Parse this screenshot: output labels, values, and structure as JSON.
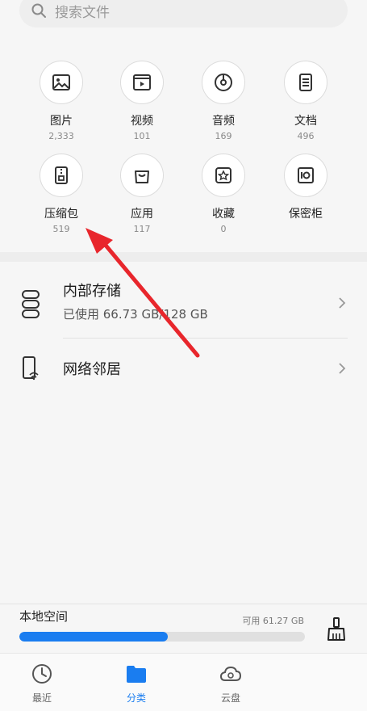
{
  "search": {
    "placeholder": "搜索文件"
  },
  "categories": [
    {
      "label": "图片",
      "count": "2,333",
      "icon": "image-icon"
    },
    {
      "label": "视频",
      "count": "101",
      "icon": "video-icon"
    },
    {
      "label": "音频",
      "count": "169",
      "icon": "audio-icon"
    },
    {
      "label": "文档",
      "count": "496",
      "icon": "document-icon"
    },
    {
      "label": "压缩包",
      "count": "519",
      "icon": "archive-icon"
    },
    {
      "label": "应用",
      "count": "117",
      "icon": "app-icon"
    },
    {
      "label": "收藏",
      "count": "0",
      "icon": "favorite-icon"
    },
    {
      "label": "保密柜",
      "count": "",
      "icon": "safe-icon"
    }
  ],
  "locations": [
    {
      "title": "内部存储",
      "subtitle": "已使用 66.73 GB/128 GB",
      "icon": "storage-icon"
    },
    {
      "title": "网络邻居",
      "subtitle": "",
      "icon": "network-device-icon"
    }
  ],
  "storage": {
    "title": "本地空间",
    "available": "可用 61.27 GB",
    "used_fraction": 0.52
  },
  "tabs": [
    {
      "label": "最近",
      "icon": "clock-icon",
      "active": false
    },
    {
      "label": "分类",
      "icon": "folder-icon",
      "active": true
    },
    {
      "label": "云盘",
      "icon": "cloud-icon",
      "active": false
    }
  ],
  "colors": {
    "accent": "#1a7df0",
    "annotation_arrow": "#e8262c"
  }
}
